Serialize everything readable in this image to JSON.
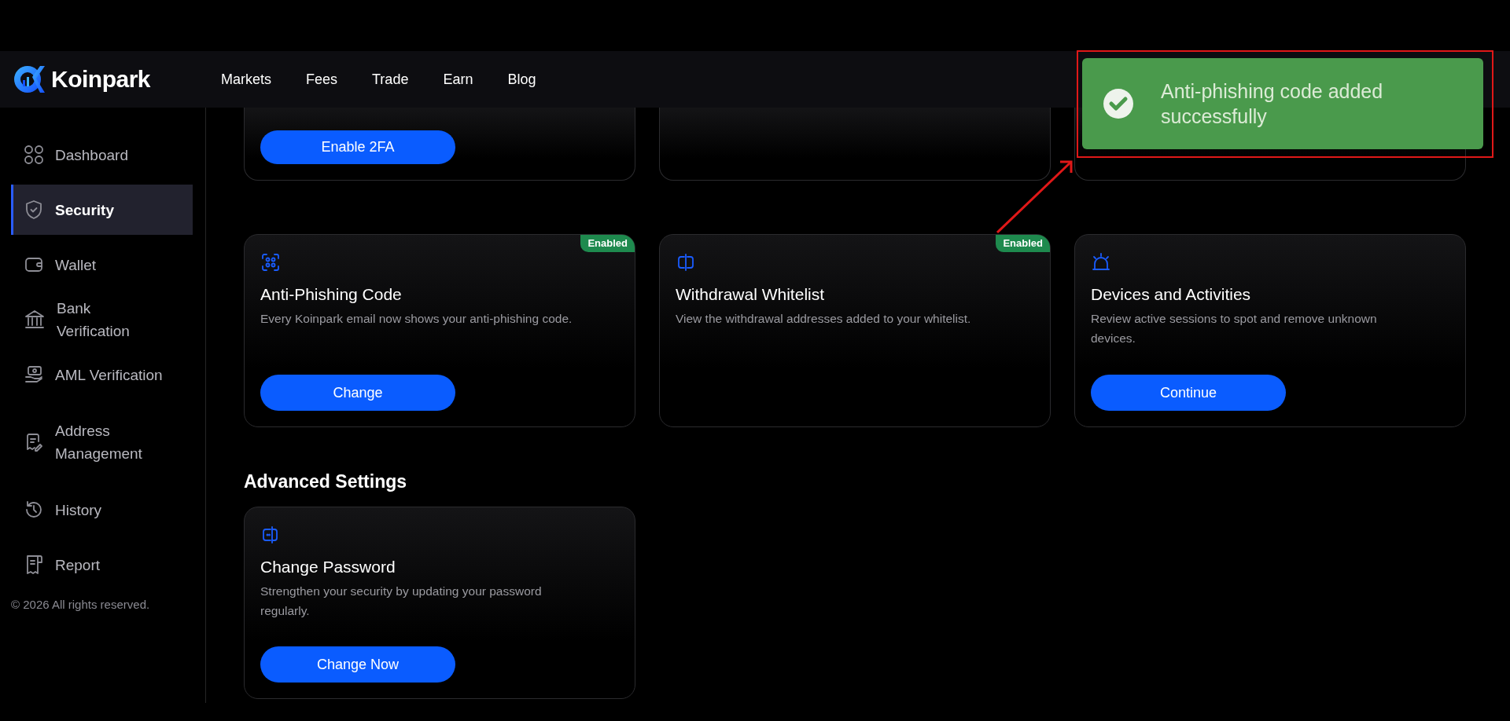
{
  "header": {
    "logo": "Koinpark",
    "nav": [
      {
        "label": "Markets"
      },
      {
        "label": "Fees"
      },
      {
        "label": "Trade"
      },
      {
        "label": "Earn"
      },
      {
        "label": "Blog"
      }
    ]
  },
  "sidebar": {
    "items": [
      {
        "label": "Dashboard",
        "selected": false
      },
      {
        "label": "Security",
        "selected": true
      },
      {
        "label": "Wallet",
        "selected": false
      },
      {
        "label": "Bank Verification",
        "selected": false
      },
      {
        "label": "AML Verification",
        "selected": false
      },
      {
        "label": "Address Management",
        "selected": false
      },
      {
        "label": "History",
        "selected": false
      },
      {
        "label": "Report",
        "selected": false
      }
    ],
    "footer": "© 2026 All rights reserved."
  },
  "top_cards": [
    {
      "kind": "button",
      "button": "Enable 2FA"
    },
    {
      "kind": "blank"
    },
    {
      "kind": "blank"
    }
  ],
  "security_cards": [
    {
      "title": "Anti-Phishing Code",
      "description": "Every Koinpark email now shows your anti-phishing code.",
      "badge": "Enabled",
      "button": "Change"
    },
    {
      "title": "Withdrawal Whitelist",
      "description": "View the withdrawal addresses added to your whitelist.",
      "badge": "Enabled"
    },
    {
      "title": "Devices and Activities",
      "description": "Review active sessions to spot and remove unknown devices.",
      "button": "Continue"
    }
  ],
  "advanced_settings": {
    "heading": "Advanced Settings",
    "cards": [
      {
        "title": "Change Password",
        "description": "Strengthen your security by updating your password regularly.",
        "button": "Change Now"
      }
    ]
  },
  "toast": {
    "message": "Anti-phishing code added successfully"
  }
}
